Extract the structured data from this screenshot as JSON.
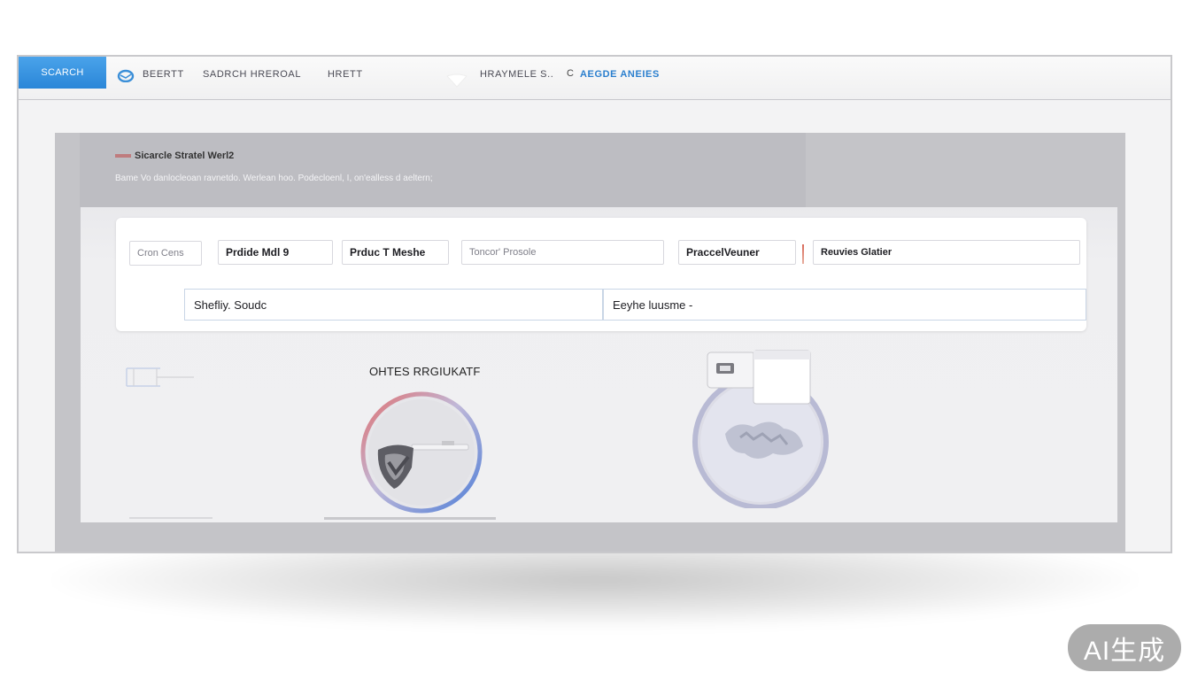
{
  "topbar": {
    "active_tab": "SCARCH",
    "nav": [
      {
        "label": "BEERTT"
      },
      {
        "label": "SADRCH HREROAL"
      },
      {
        "label": "HRETT"
      },
      {
        "label": "HRAYMELE S.."
      },
      {
        "label": "AEGDE ANEIES"
      }
    ],
    "c_glyph": "C"
  },
  "hero": {
    "title": "Sicarcle Stratel Werl2",
    "subtitle": "Bame Vo danlocleoan ravnetdo. Werlean hoo. Podecloenl, I, on'ealless d aeltern;"
  },
  "search": {
    "fields": [
      {
        "value": "Cron Cens"
      },
      {
        "value": "Prdide Mdl 9"
      },
      {
        "value": "Prduc T Meshe"
      },
      {
        "value": "Toncor' Prosole"
      },
      {
        "value": "PraccelVeuner"
      },
      {
        "value": "Reuvies Glatier"
      }
    ],
    "left_input": "Shefliy. Soudc",
    "right_input": "Eeyhe luusme -"
  },
  "cards": {
    "heading": "OHTES RRGIUKATF"
  },
  "watermark": "AI生成"
}
